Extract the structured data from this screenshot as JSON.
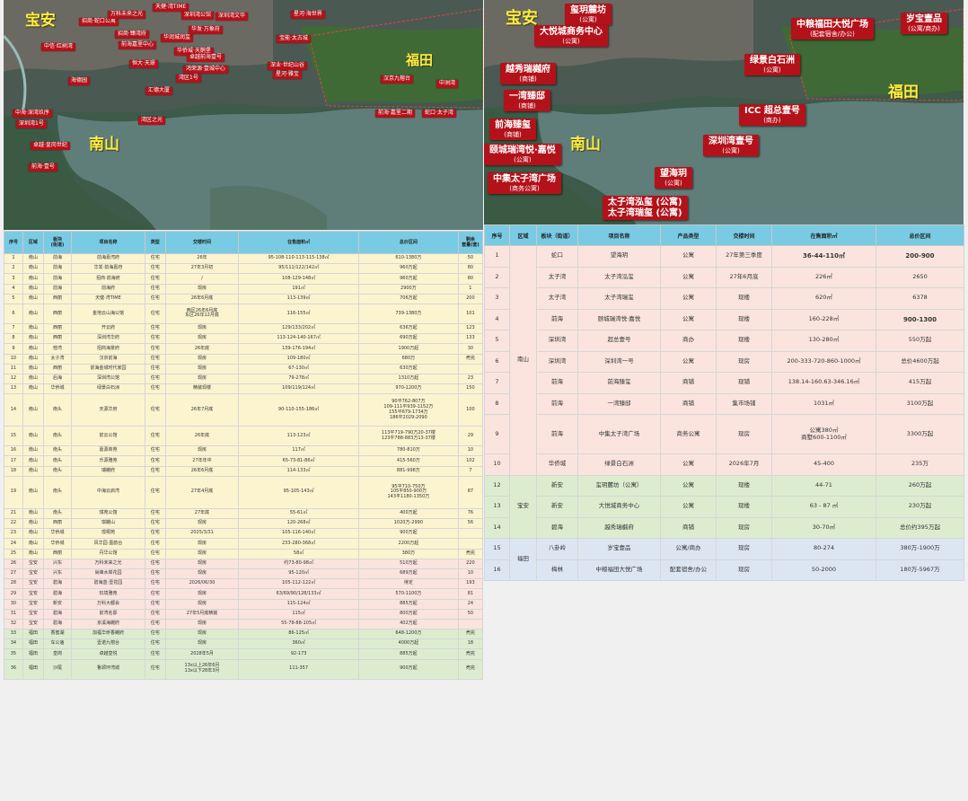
{
  "left_map": {
    "areas": {
      "baoan": "宝安",
      "nanshan": "南山",
      "futian": "福田"
    },
    "labels": [
      "招商·蛇口公寓",
      "万科未来之光",
      "天健·湾TIME",
      "深圳湾公馆",
      "深圳湾文华",
      "星河·海世界",
      "招商·臻湾府",
      "华润城润玺",
      "华发·万象府",
      "中信·红树湾",
      "前海嘉里中心",
      "华侨城·天鹅堡",
      "卓越前海壹号",
      "宝能·太古城",
      "恒大·天璟",
      "深业·世纪山谷",
      "鸿荣源·壹城中心",
      "星河·雅宝",
      "海德园",
      "湾区1号",
      "汉京九榕台",
      "中洲湾",
      "汇德大厦",
      "中海·深湾玖序",
      "前海·嘉里二期",
      "蛇口·太子湾",
      "湾区之光",
      "深圳湾1号",
      "卓越·皇岗世纪",
      "前海·壹号"
    ]
  },
  "right_map": {
    "areas": {
      "baoan": "宝安",
      "nanshan": "南山",
      "futian": "福田"
    },
    "labels": [
      {
        "name": "玺玥麓坊",
        "sub": "(公寓)"
      },
      {
        "name": "大悦城商务中心",
        "sub": "(公寓)"
      },
      {
        "name": "越秀瑞樾府",
        "sub": "(商铺)"
      },
      {
        "name": "一湾臻邸",
        "sub": "(商铺)"
      },
      {
        "name": "前海臻玺",
        "sub": "(商铺)"
      },
      {
        "name": "颐城瑞湾悦·嘉悦",
        "sub": "(公寓)"
      },
      {
        "name": "中集太子湾广场",
        "sub": "(商务公寓)"
      },
      {
        "name": "太子湾泓玺 (公寓)",
        "sub": ""
      },
      {
        "name": "太子湾瑞玺 (公寓)",
        "sub": ""
      },
      {
        "name": "望海玥",
        "sub": "(公寓)"
      },
      {
        "name": "深圳湾壹号",
        "sub": "(公寓)"
      },
      {
        "name": "ICC 超总壹号",
        "sub": "(商办)"
      },
      {
        "name": "绿景白石洲",
        "sub": "(公寓)"
      },
      {
        "name": "中粮福田大悦广场",
        "sub": "(配套宿舍/办公)"
      },
      {
        "name": "岁宝壹品",
        "sub": "(公寓/商办)"
      }
    ]
  },
  "left_table": {
    "headers": [
      "序号",
      "区域",
      "板块\n(街道)",
      "项目名称",
      "类型",
      "交楼时间",
      "在售面积㎡",
      "总价区间",
      "剩余\n套量(套)"
    ],
    "rows": [
      {
        "c": [
          "1",
          "南山",
          "前海",
          "前海嘉湾府",
          "住宅",
          "26年",
          "95-108-110-113-115-138㎡",
          "610-1380万",
          "50"
        ],
        "k": "ns"
      },
      {
        "c": [
          "2",
          "南山",
          "前海",
          "华发·前海嘉府",
          "住宅",
          "27年3月初",
          "95/111/122/142㎡",
          "960万起",
          "80"
        ],
        "k": "ns"
      },
      {
        "c": [
          "3",
          "南山",
          "前海",
          "招商·前海府",
          "住宅",
          "/",
          "108-129-148㎡",
          "960万起",
          "80"
        ],
        "k": "ns"
      },
      {
        "c": [
          "4",
          "南山",
          "前海",
          "前海府",
          "住宅",
          "现房",
          "191㎡",
          "2900万",
          "1"
        ],
        "k": "ns"
      },
      {
        "c": [
          "5",
          "南山",
          "西丽",
          "天健·湾TIME",
          "住宅",
          "26年6月底",
          "113-139㎡",
          "706万起",
          "200"
        ],
        "k": "ns"
      },
      {
        "c": [
          "6",
          "南山",
          "西丽",
          "金地云山海公馆",
          "住宅",
          "西区26年6月底\n东区26年12月底",
          "116-155㎡",
          "739-1380万",
          "101"
        ],
        "k": "ns tall"
      },
      {
        "c": [
          "7",
          "南山",
          "西丽",
          "开云府",
          "住宅",
          "现房",
          "129/133/202㎡",
          "636万起",
          "123"
        ],
        "k": "ns"
      },
      {
        "c": [
          "8",
          "南山",
          "西丽",
          "深圳湾华府",
          "住宅",
          "现房",
          "113-124-140-167㎡",
          "690万起",
          "133"
        ],
        "k": "ns"
      },
      {
        "c": [
          "9",
          "南山",
          "桂湾",
          "招商海景府",
          "住宅",
          "26年底",
          "139-176-194㎡",
          "1900万起",
          "30"
        ],
        "k": "ns"
      },
      {
        "c": [
          "10",
          "南山",
          "太子湾",
          "汉京前海",
          "住宅",
          "现房",
          "109-180㎡",
          "680万",
          "売完"
        ],
        "k": "ns"
      },
      {
        "c": [
          "11",
          "南山",
          "西丽",
          "前海金城时代家园",
          "住宅",
          "现房",
          "67-130㎡",
          "630万起",
          ""
        ],
        "k": "ns"
      },
      {
        "c": [
          "12",
          "南山",
          "后海",
          "深圳湾公馆",
          "住宅",
          "现房",
          "79-278㎡",
          "1310万起",
          "23"
        ],
        "k": "ns"
      },
      {
        "c": [
          "13",
          "南山",
          "华侨城",
          "绿景白石洲",
          "住宅",
          "精装现楼",
          "109/119/124㎡",
          "970-1200万",
          "150"
        ],
        "k": "ns"
      },
      {
        "c": [
          "14",
          "南山",
          "南头",
          "天源华府",
          "住宅",
          "26年7月底",
          "90-110-155-186㎡",
          "90平762-807万\n109-111平939-1152万\n155平679-1734万\n186平2029-2090",
          "100"
        ],
        "k": "ns xtall"
      },
      {
        "c": [
          "15",
          "南山",
          "南头",
          "前云公馆",
          "住宅",
          "26年底",
          "113-123㎡",
          "113平719-790万20-37楼\n123平788-883万13-37楼",
          "29"
        ],
        "k": "ns tall"
      },
      {
        "c": [
          "16",
          "南山",
          "南头",
          "嘉源商苑",
          "住宅",
          "现房",
          "117㎡",
          "780-810万",
          "10"
        ],
        "k": "ns"
      },
      {
        "c": [
          "17",
          "南山",
          "南头",
          "乐源雅苑",
          "住宅",
          "27年年中",
          "65-73-81-86㎡",
          "415-560万",
          "102"
        ],
        "k": "ns"
      },
      {
        "c": [
          "18",
          "南山",
          "南头",
          "瑞樾府",
          "住宅",
          "26年6月底",
          "114-133㎡",
          "881-998万",
          "7"
        ],
        "k": "ns"
      },
      {
        "c": [
          "19",
          "南山",
          "南头",
          "中海云启湾",
          "住宅",
          "27年4月底",
          "95-105-143㎡",
          "95平710-750万\n105平850-900万\n143平1180-1350万",
          "87"
        ],
        "k": "ns xtall"
      },
      {
        "c": [
          "21",
          "南山",
          "南头",
          "琪苑公馆",
          "住宅",
          "27年底",
          "55-61㎡",
          "400万起",
          "76"
        ],
        "k": "ns"
      },
      {
        "c": [
          "22",
          "南山",
          "西丽",
          "琪樾山",
          "住宅",
          "现房",
          "120-268㎡",
          "1020万-2990",
          "56"
        ],
        "k": "ns"
      },
      {
        "c": [
          "23",
          "南山",
          "华侨城",
          "璟桐苑",
          "住宅",
          "2025/3/31",
          "105-116-140㎡",
          "900万起",
          ""
        ],
        "k": "ns"
      },
      {
        "c": [
          "24",
          "南山",
          "华侨城",
          "风华园·墨韵台",
          "住宅",
          "现房",
          "233-280-368㎡",
          "2200万起",
          ""
        ],
        "k": "ns"
      },
      {
        "c": [
          "25",
          "南山",
          "西丽",
          "丹华公馆",
          "住宅",
          "现房",
          "58㎡",
          "380万",
          "売完"
        ],
        "k": "ns"
      },
      {
        "c": [
          "26",
          "宝安",
          "兴东",
          "万科未来之光",
          "住宅",
          "现房",
          "约73-80-98㎡",
          "510万起",
          "220"
        ],
        "k": "ba"
      },
      {
        "c": [
          "27",
          "宝安",
          "兴东",
          "尚峰水岸花园",
          "住宅",
          "现房",
          "95-120㎡",
          "689万起",
          "10"
        ],
        "k": "ba"
      },
      {
        "c": [
          "28",
          "宝安",
          "碧海",
          "碧海蓝·壹花园",
          "住宅",
          "2026/06/30",
          "105-112-122㎡",
          "待定",
          "193"
        ],
        "k": "ba"
      },
      {
        "c": [
          "29",
          "宝安",
          "碧海",
          "玖境雅苑",
          "住宅",
          "现房",
          "63/69/90/128/133㎡",
          "570-1100万",
          "81"
        ],
        "k": "ba"
      },
      {
        "c": [
          "30",
          "宝安",
          "新安",
          "万科大都会",
          "住宅",
          "现房",
          "115-124㎡",
          "885万起",
          "24"
        ],
        "k": "ba"
      },
      {
        "c": [
          "31",
          "宝安",
          "碧海",
          "前湾名邸",
          "住宅",
          "27年5月底精装",
          "115㎡",
          "800万起",
          "50"
        ],
        "k": "ba"
      },
      {
        "c": [
          "32",
          "宝安",
          "碧海",
          "京溪海樾府",
          "住宅",
          "现房",
          "55-78-88-105㎡",
          "402万起",
          ""
        ],
        "k": "ba"
      },
      {
        "c": [
          "33",
          "福田",
          "香蜜湖",
          "加福华侨香樾府",
          "住宅",
          "现房",
          "86-125㎡",
          "648-1200万",
          "売完"
        ],
        "k": "ft"
      },
      {
        "c": [
          "34",
          "福田",
          "车公庙",
          "壹诺九榕台",
          "住宅",
          "现房",
          "360㎡",
          "4000万起",
          "18"
        ],
        "k": "ft"
      },
      {
        "c": [
          "35",
          "福田",
          "皇岗",
          "卓越皇悦",
          "住宅",
          "2028年5月",
          "92-173",
          "885万起",
          "売完"
        ],
        "k": "ft"
      },
      {
        "c": [
          "36",
          "福田",
          "沙尾",
          "鲁颂环湾城",
          "住宅",
          "13x以上26年6月\n13x以下28年3月",
          "111-357",
          "900万起",
          "売完"
        ],
        "k": "ft tall"
      }
    ]
  },
  "right_table": {
    "headers": [
      "序号",
      "区域",
      "板块（街道）",
      "项目名称",
      "产品类型",
      "交楼时间",
      "在售面积㎡",
      "总价区间"
    ],
    "region_nanshan": "南山",
    "region_baoan": "宝安",
    "region_futian": "福田",
    "rows_nanshan": [
      {
        "c": [
          "1",
          "蛇口",
          "望海玥",
          "公寓",
          "27年第三季度",
          "36-44-110㎡",
          "200-900"
        ],
        "bold": [
          5,
          6
        ]
      },
      {
        "c": [
          "2",
          "太子湾",
          "太子湾泓玺",
          "公寓",
          "27年6月底",
          "226㎡",
          "2650"
        ],
        "bold": []
      },
      {
        "c": [
          "3",
          "太子湾",
          "太子湾瑞玺",
          "公寓",
          "现楼",
          "620㎡",
          "6378"
        ],
        "bold": []
      },
      {
        "c": [
          "4",
          "前海",
          "颐城瑞湾悦·嘉悦",
          "公寓",
          "现楼",
          "160-228㎡",
          "900-1300"
        ],
        "bold": [
          6
        ]
      },
      {
        "c": [
          "5",
          "深圳湾",
          "超总壹号",
          "商办",
          "现楼",
          "130-280㎡",
          "550万起"
        ],
        "bold": []
      },
      {
        "c": [
          "6",
          "深圳湾",
          "深圳湾一号",
          "公寓",
          "现房",
          "200-333-720-860-1000㎡",
          "总价4600万起"
        ],
        "bold": []
      },
      {
        "c": [
          "7",
          "前海",
          "前海臻玺",
          "商铺",
          "现铺",
          "138.14-160.63-346.16㎡",
          "415万起"
        ],
        "bold": []
      },
      {
        "c": [
          "8",
          "前海",
          "一湾臻邸",
          "商铺",
          "集市场铺",
          "1031㎡",
          "3100万起"
        ],
        "bold": []
      },
      {
        "c": [
          "9",
          "前海",
          "中集太子湾广场",
          "商务公寓",
          "现房",
          "公寓380㎡\n商墅600-1100㎡",
          "3300万起"
        ],
        "bold": [],
        "tall": true
      },
      {
        "c": [
          "10",
          "华侨城",
          "绿景白石洲",
          "公寓",
          "2026年7月",
          "45-400",
          "235万"
        ],
        "bold": []
      }
    ],
    "rows_baoan": [
      {
        "c": [
          "12",
          "新安",
          "玺玥麓坊（公寓）",
          "公寓",
          "现楼",
          "44-71",
          "260万起"
        ]
      },
      {
        "c": [
          "13",
          "新安",
          "大悦城商务中心",
          "公寓",
          "现楼",
          "63 - 87 ㎡",
          "230万起"
        ]
      },
      {
        "c": [
          "14",
          "碧海",
          "越秀瑞樾府",
          "商铺",
          "现房",
          "30-70㎡",
          "总价约395万起"
        ]
      }
    ],
    "rows_futian": [
      {
        "c": [
          "15",
          "八卦岭",
          "岁宝壹品",
          "公寓/商办",
          "现房",
          "80-274",
          "380万-1900万"
        ]
      },
      {
        "c": [
          "16",
          "梅林",
          "中粮福田大悦广场",
          "配套宿舍/办公",
          "现房",
          "50-2000",
          "180万-5967万"
        ]
      }
    ]
  },
  "colors": {
    "label_red": "#b3121a",
    "header_blue": "#79cbe4",
    "nanshan_yellow": "#fcf4cf",
    "nanshan_pink": "#fbe4de",
    "baoan_green": "#dcedcf",
    "futian_blue": "#dce6f3",
    "area_yellow": "#ffef3a"
  }
}
